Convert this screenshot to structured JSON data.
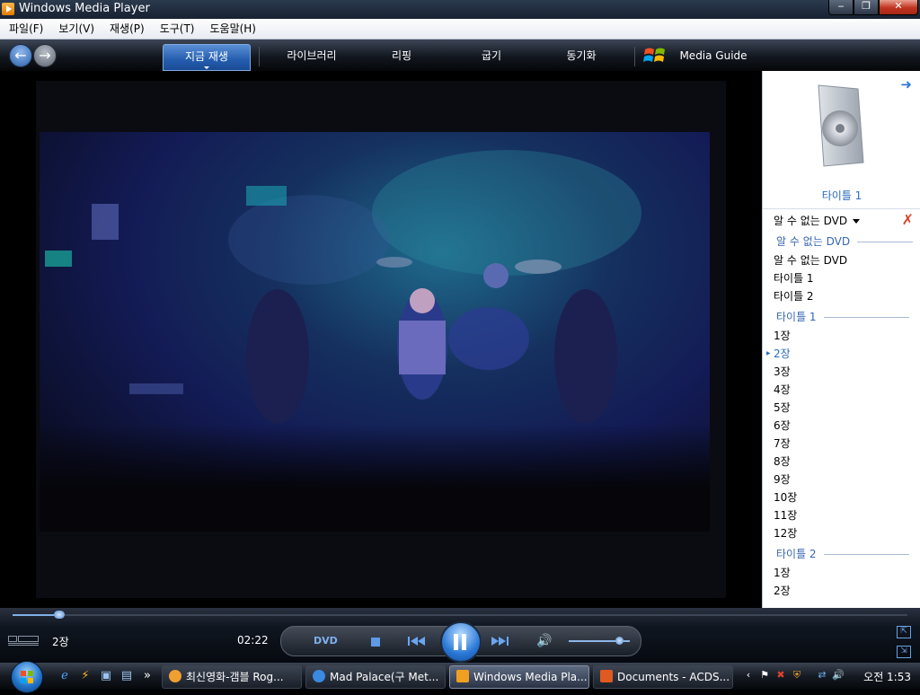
{
  "window": {
    "title": "Windows Media Player",
    "buttons": {
      "minimize": "‒",
      "maximize": "❐",
      "close": "✕"
    }
  },
  "menu": [
    "파일(F)",
    "보기(V)",
    "재생(P)",
    "도구(T)",
    "도움말(H)"
  ],
  "nav": {
    "back": "←",
    "forward": "→",
    "tabs": [
      "지금 재생",
      "라이브러리",
      "리핑",
      "굽기",
      "동기화",
      "Media Guide"
    ],
    "active_tab": "지금 재생"
  },
  "panel": {
    "title_label": "타이틀 1",
    "playlist_header": "알 수 없는 DVD",
    "sections": [
      {
        "heading": "알 수 없는 DVD",
        "items": [
          "알 수 없는 DVD",
          "타이틀 1",
          "타이틀 2"
        ]
      },
      {
        "heading": "타이틀 1",
        "items": [
          "1장",
          "2장",
          "3장",
          "4장",
          "5장",
          "6장",
          "7장",
          "8장",
          "9장",
          "10장",
          "11장",
          "12장"
        ]
      },
      {
        "heading": "타이틀 2",
        "items": [
          "1장",
          "2장"
        ]
      }
    ],
    "current_item": "2장"
  },
  "controls": {
    "chapter": "2장",
    "elapsed": "02:22",
    "dvd_label": "DVD",
    "seek_progress": 0.052,
    "volume": 0.82,
    "dolby_label": "DOLBY DIGITAL"
  },
  "taskbar": {
    "buttons": [
      "최신영화-갬블 Rog...",
      "Mad Palace(구 Met...",
      "Windows Media Pla...",
      "Documents - ACDS..."
    ],
    "active": "Windows Media Pla...",
    "clock": "오전 1:53"
  },
  "colors": {
    "accent": "#2a6cc0",
    "nav_active": "#245dae",
    "chrome_dark": "#12171f"
  }
}
